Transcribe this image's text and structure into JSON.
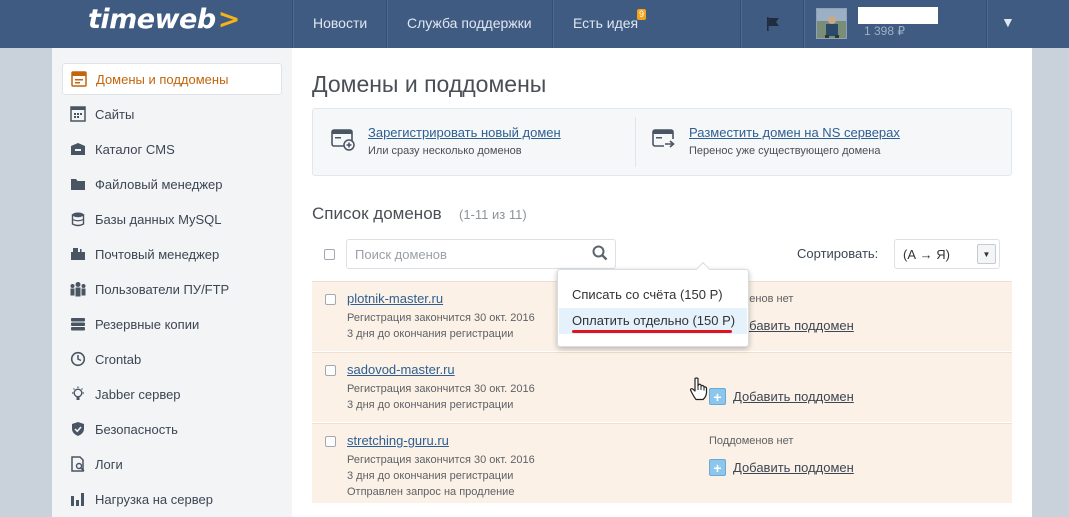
{
  "header": {
    "logo_text": "timeweb",
    "logo_arrow": ">",
    "nav": [
      "Новости",
      "Служба поддержки",
      "Есть идея"
    ],
    "idea_badge": "9",
    "balance": "1 398 ₽",
    "dropdown": "▼"
  },
  "sidebar": {
    "items": [
      {
        "label": "Домены и поддомены",
        "icon": "domains-icon",
        "active": true
      },
      {
        "label": "Сайты",
        "icon": "sites-icon"
      },
      {
        "label": "Каталог CMS",
        "icon": "cms-catalog-icon"
      },
      {
        "label": "Файловый менеджер",
        "icon": "folder-icon"
      },
      {
        "label": "Базы данных MySQL",
        "icon": "database-icon"
      },
      {
        "label": "Почтовый менеджер",
        "icon": "mailbox-icon"
      },
      {
        "label": "Пользователи ПУ/FTP",
        "icon": "users-icon"
      },
      {
        "label": "Резервные копии",
        "icon": "backup-icon"
      },
      {
        "label": "Crontab",
        "icon": "clock-icon"
      },
      {
        "label": "Jabber сервер",
        "icon": "lightbulb-icon"
      },
      {
        "label": "Безопасность",
        "icon": "shield-icon"
      },
      {
        "label": "Логи",
        "icon": "logs-icon"
      },
      {
        "label": "Нагрузка на сервер",
        "icon": "bar-chart-icon"
      }
    ]
  },
  "main": {
    "title": "Домены и поддомены",
    "actions": [
      {
        "link": "Зарегистрировать новый домен",
        "sub": "Или сразу несколько доменов"
      },
      {
        "link": "Разместить домен на NS серверах",
        "sub": "Перенос уже существующего домена"
      }
    ],
    "list_title": "Список доменов",
    "list_count": "(1-11 из 11)",
    "search_placeholder": "Поиск доменов",
    "sort_label": "Сортировать:",
    "sort_value": "(А → Я)"
  },
  "domains": [
    {
      "name": "plotnik-master.ru",
      "expires": "Регистрация закончится 30 окт. 2016",
      "days_left": "3 дня до окончания регистрации",
      "note": "",
      "subdomains": "Поддоменов нет",
      "add_label": "Добавить поддомен"
    },
    {
      "name": "sadovod-master.ru",
      "expires": "Регистрация закончится 30 окт. 2016",
      "days_left": "3 дня до окончания регистрации",
      "note": "",
      "subdomains": "",
      "add_label": "Добавить поддомен"
    },
    {
      "name": "stretching-guru.ru",
      "expires": "Регистрация закончится 30 окт. 2016",
      "days_left": "3 дня до окончания регистрации",
      "note": "Отправлен запрос на продление",
      "subdomains": "Поддоменов нет",
      "add_label": "Добавить поддомен"
    }
  ],
  "popup": {
    "option_debit": "Списать со счёта (150 Р)",
    "option_separate": "Оплатить отдельно (150 Р)"
  }
}
